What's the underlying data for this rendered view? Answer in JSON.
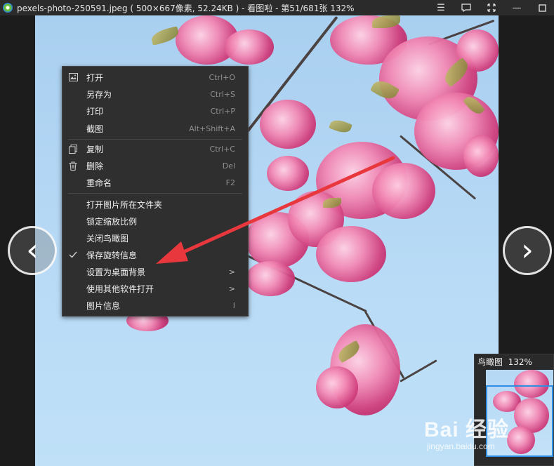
{
  "window": {
    "title": "pexels-photo-250591.jpeg ( 500×667像素, 52.24KB ) - 看图啦 - 第51/681张 132%",
    "controls": [
      "menu-icon",
      "feedback-icon",
      "fullscreen-icon",
      "minimize-icon",
      "maximize-icon"
    ]
  },
  "nav": {
    "prev": "‹",
    "next": "›"
  },
  "context_menu": {
    "items": [
      {
        "label": "打开",
        "shortcut": "Ctrl+O",
        "icon": "image-icon"
      },
      {
        "label": "另存为",
        "shortcut": "Ctrl+S"
      },
      {
        "label": "打印",
        "shortcut": "Ctrl+P"
      },
      {
        "label": "截图",
        "shortcut": "Alt+Shift+A"
      },
      {
        "label": "复制",
        "shortcut": "Ctrl+C",
        "icon": "copy-icon"
      },
      {
        "label": "删除",
        "shortcut": "Del",
        "icon": "trash-icon"
      },
      {
        "label": "重命名",
        "shortcut": "F2"
      },
      {
        "label": "打开图片所在文件夹"
      },
      {
        "label": "锁定缩放比例"
      },
      {
        "label": "关闭鸟瞰图"
      },
      {
        "label": "保存旋转信息",
        "checked": true
      },
      {
        "label": "设置为桌面背景",
        "submenu": true
      },
      {
        "label": "使用其他软件打开",
        "submenu": true
      },
      {
        "label": "图片信息",
        "shortcut": "I"
      }
    ]
  },
  "navigator": {
    "title": "鸟瞰图",
    "zoom": "132%"
  },
  "watermark": {
    "main": "Bai 经验",
    "sub": "jingyan.baidu.com"
  },
  "colors": {
    "accent": "#2f8de4",
    "annotation": "#e8383d"
  }
}
